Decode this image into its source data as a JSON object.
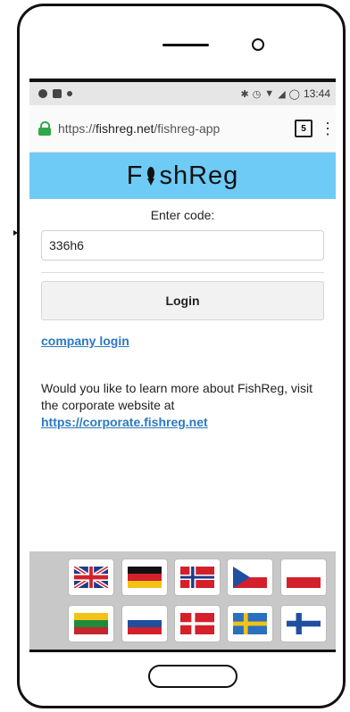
{
  "status_bar": {
    "time": "13:44",
    "right_icons": [
      "bluetooth-icon",
      "alarm-icon",
      "wifi-icon",
      "signal-icon",
      "battery-icon"
    ]
  },
  "browser": {
    "url_host": "fishreg.net",
    "url_prefix": "https://",
    "url_path": "/fishreg-app",
    "tab_count": "5"
  },
  "app": {
    "logo_prefix": "F",
    "logo_suffix": "shReg",
    "enter_code_label": "Enter code:",
    "code_value": "336h6",
    "login_label": "Login",
    "company_login_label": "company login",
    "info_text": "Would you like to learn more about FishReg, visit the corporate website at",
    "info_link": "https://corporate.fishreg.net"
  },
  "languages": [
    "English (UK)",
    "German",
    "Norwegian",
    "Czech",
    "Polish",
    "Lithuanian",
    "Russian",
    "Danish",
    "Swedish",
    "Finnish"
  ],
  "colors": {
    "banner": "#6ecbf5",
    "link": "#2b79c2",
    "secure_lock": "#2fa84a"
  }
}
